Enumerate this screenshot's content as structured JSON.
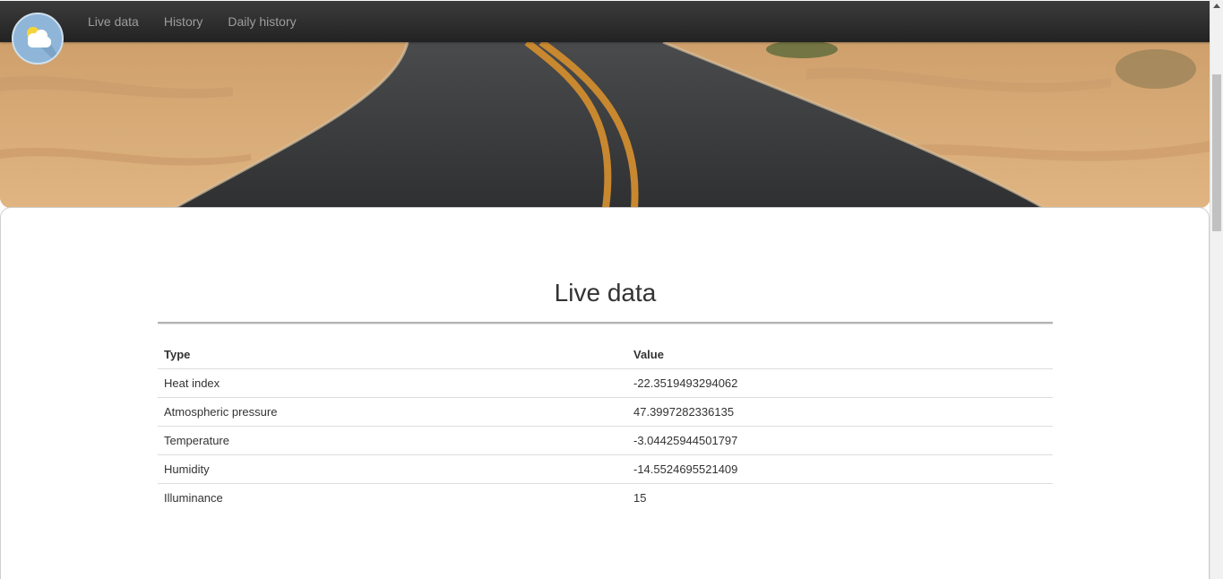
{
  "nav": {
    "links": [
      {
        "label": "Live data"
      },
      {
        "label": "History"
      },
      {
        "label": "Daily history"
      }
    ]
  },
  "logo": {
    "icon": "cloud-sun-icon"
  },
  "main": {
    "title": "Live data",
    "table": {
      "headers": {
        "type": "Type",
        "value": "Value"
      },
      "rows": [
        {
          "type": "Heat index",
          "value": "-22.3519493294062"
        },
        {
          "type": "Atmospheric pressure",
          "value": "47.3997282336135"
        },
        {
          "type": "Temperature",
          "value": "-3.04425944501797"
        },
        {
          "type": "Humidity",
          "value": "-14.5524695521409"
        },
        {
          "type": "Illuminance",
          "value": "15"
        }
      ]
    }
  },
  "colors": {
    "navbar": "#222222",
    "nav_text": "#9d9d9d",
    "sand": "#d7a974",
    "asphalt": "#3a3a3c",
    "road_line": "#c8882f"
  }
}
